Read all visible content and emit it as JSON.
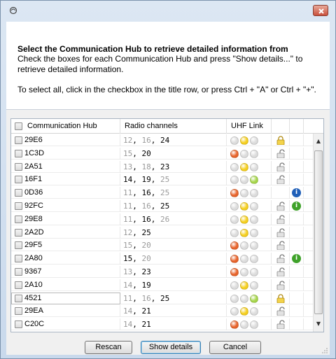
{
  "window": {
    "title": ""
  },
  "header": {
    "title": "Select the Communication Hub to retrieve detailed information from",
    "line1": "Check the boxes for each Communication Hub and press \"Show details...\" to",
    "line2": "retrieve detailed information.",
    "line3": "To select all, click in the checkbox in the title row, or press Ctrl + \"A\" or Ctrl + \"+\"."
  },
  "table": {
    "columns": [
      "Communication Hub",
      "Radio channels",
      "UHF Link"
    ],
    "rows": [
      {
        "hub": "29E6",
        "ch": [
          [
            "12",
            "g"
          ],
          [
            ", ",
            ""
          ],
          [
            "16",
            "g"
          ],
          [
            ", ",
            ""
          ],
          [
            "24",
            "b"
          ]
        ],
        "uhf": [
          "grey",
          "yellow",
          "grey"
        ],
        "lock": "gold",
        "info": ""
      },
      {
        "hub": "1C3D",
        "ch": [
          [
            "15",
            "g"
          ],
          [
            ", ",
            ""
          ],
          [
            "20",
            "b"
          ]
        ],
        "uhf": [
          "red",
          "grey",
          "grey"
        ],
        "lock": "open",
        "info": ""
      },
      {
        "hub": "2A51",
        "ch": [
          [
            "13",
            "g"
          ],
          [
            ", ",
            ""
          ],
          [
            "18",
            "g"
          ],
          [
            ", ",
            ""
          ],
          [
            "23",
            "b"
          ]
        ],
        "uhf": [
          "grey",
          "yellow",
          "grey"
        ],
        "lock": "open",
        "info": ""
      },
      {
        "hub": "16F1",
        "ch": [
          [
            "14",
            "b"
          ],
          [
            ", ",
            ""
          ],
          [
            "19",
            "b"
          ],
          [
            ", ",
            ""
          ],
          [
            "25",
            "g"
          ]
        ],
        "uhf": [
          "grey",
          "grey",
          "green"
        ],
        "lock": "open",
        "info": ""
      },
      {
        "hub": "0D36",
        "ch": [
          [
            "11",
            "g"
          ],
          [
            ", ",
            ""
          ],
          [
            "16",
            "b"
          ],
          [
            ", ",
            ""
          ],
          [
            "25",
            "g"
          ]
        ],
        "uhf": [
          "red",
          "grey",
          "grey"
        ],
        "lock": "",
        "info": "blue"
      },
      {
        "hub": "92FC",
        "ch": [
          [
            "11",
            "g"
          ],
          [
            ", ",
            ""
          ],
          [
            "16",
            "g"
          ],
          [
            ", ",
            ""
          ],
          [
            "25",
            "b"
          ]
        ],
        "uhf": [
          "grey",
          "yellow",
          "grey"
        ],
        "lock": "open",
        "info": "green"
      },
      {
        "hub": "29E8",
        "ch": [
          [
            "11",
            "g"
          ],
          [
            ", ",
            ""
          ],
          [
            "16",
            "b"
          ],
          [
            ", ",
            ""
          ],
          [
            "26",
            "g"
          ]
        ],
        "uhf": [
          "grey",
          "yellow",
          "grey"
        ],
        "lock": "open",
        "info": ""
      },
      {
        "hub": "2A2D",
        "ch": [
          [
            "12",
            "g"
          ],
          [
            ", ",
            ""
          ],
          [
            "25",
            "b"
          ]
        ],
        "uhf": [
          "grey",
          "yellow",
          "grey"
        ],
        "lock": "open",
        "info": ""
      },
      {
        "hub": "29F5",
        "ch": [
          [
            "15",
            "g"
          ],
          [
            ", ",
            ""
          ],
          [
            "20",
            "g"
          ]
        ],
        "uhf": [
          "red",
          "grey",
          "grey"
        ],
        "lock": "open",
        "info": ""
      },
      {
        "hub": "2A80",
        "ch": [
          [
            "15",
            "b"
          ],
          [
            ", ",
            ""
          ],
          [
            "20",
            "g"
          ]
        ],
        "uhf": [
          "red",
          "grey",
          "grey"
        ],
        "lock": "open",
        "info": "green"
      },
      {
        "hub": "9367",
        "ch": [
          [
            "13",
            "g"
          ],
          [
            ", ",
            ""
          ],
          [
            "23",
            "b"
          ]
        ],
        "uhf": [
          "red",
          "grey",
          "grey"
        ],
        "lock": "open",
        "info": ""
      },
      {
        "hub": "2A10",
        "ch": [
          [
            "14",
            "g"
          ],
          [
            ", ",
            ""
          ],
          [
            "19",
            "b"
          ]
        ],
        "uhf": [
          "grey",
          "yellow",
          "grey"
        ],
        "lock": "open",
        "info": ""
      },
      {
        "hub": "4521",
        "ch": [
          [
            "11",
            "g"
          ],
          [
            ", ",
            ""
          ],
          [
            "16",
            "g"
          ],
          [
            ", ",
            ""
          ],
          [
            "25",
            "b"
          ]
        ],
        "uhf": [
          "grey",
          "grey",
          "green"
        ],
        "lock": "gold",
        "info": ""
      },
      {
        "hub": "29EA",
        "ch": [
          [
            "14",
            "g"
          ],
          [
            ", ",
            ""
          ],
          [
            "21",
            "b"
          ]
        ],
        "uhf": [
          "grey",
          "yellow",
          "grey"
        ],
        "lock": "open",
        "info": ""
      },
      {
        "hub": "C20C",
        "ch": [
          [
            "14",
            "g"
          ],
          [
            ", ",
            ""
          ],
          [
            "21",
            "b"
          ]
        ],
        "uhf": [
          "red",
          "grey",
          "grey"
        ],
        "lock": "open",
        "info": ""
      }
    ]
  },
  "buttons": {
    "rescan": "Rescan",
    "show_details": "Show details",
    "cancel": "Cancel"
  },
  "colors": {
    "red": "#e8632a",
    "yellow": "#f5cf1e",
    "green": "#a6d64a",
    "grey": "#dcdcdc",
    "info_blue": "#1f5fb8",
    "info_green": "#3fa22a"
  }
}
